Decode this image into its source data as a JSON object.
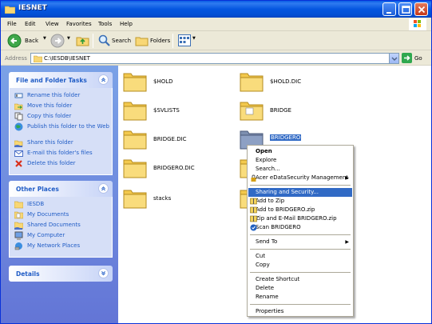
{
  "window": {
    "title": "IESNET"
  },
  "menu": [
    "File",
    "Edit",
    "View",
    "Favorites",
    "Tools",
    "Help"
  ],
  "toolbar": {
    "back": "Back",
    "search": "Search",
    "folders": "Folders"
  },
  "address": {
    "label": "Address",
    "value": "C:\\IESDB\\IESNET",
    "go": "Go"
  },
  "tasks_panel": {
    "title": "File and Folder Tasks",
    "items": [
      "Rename this folder",
      "Move this folder",
      "Copy this folder",
      "Publish this folder to the Web",
      "Share this folder",
      "E-mail this folder's files",
      "Delete this folder"
    ]
  },
  "places_panel": {
    "title": "Other Places",
    "items": [
      "IESDB",
      "My Documents",
      "Shared Documents",
      "My Computer",
      "My Network Places"
    ]
  },
  "details_panel": {
    "title": "Details"
  },
  "folders": [
    "$HOLD",
    "$HOLD.DIC",
    "$SVLISTS",
    "BRIDGE",
    "BRIDGE.DIC",
    "BRIDGERO",
    "BRIDGERO.DIC",
    "",
    "stacks",
    ""
  ],
  "context_menu": {
    "items": [
      "Open",
      "Explore",
      "Search...",
      "Acer eDataSecurity Management",
      "Sharing and Security...",
      "Add to Zip",
      "Add to BRIDGERO.zip",
      "Zip and E-Mail BRIDGERO.zip",
      "Scan BRIDGERO",
      "Send To",
      "Cut",
      "Copy",
      "Create Shortcut",
      "Delete",
      "Rename",
      "Properties"
    ]
  },
  "colors": {
    "titlebar": "#0556e0",
    "selection": "#316ac5",
    "link": "#215dc6",
    "taskpane": "#7ba2e7"
  }
}
